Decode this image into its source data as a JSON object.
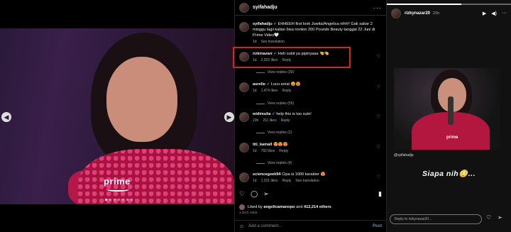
{
  "post": {
    "media_logo": "prime",
    "carousel": {
      "count": 7,
      "active": 0
    },
    "prev_icon": "chevron-left-icon",
    "next_icon": "chevron-right-icon"
  },
  "panel": {
    "username": "syifahadju",
    "more": "···",
    "caption": {
      "username": "syifahadju",
      "text": "EHHEEH first look Juwita/Angelica nihh!! Gak sabar 2 minggu lagii kalian bisa nonton 200 Pounds Beauty tanggal 22 Juni di Prime Video🤍",
      "time": "1d",
      "action": "See translation"
    },
    "comments": [
      {
        "username": "rizkinazarr",
        "text": "Heh cubit ya pipinyaaa 🤏🤏",
        "time": "1d",
        "likes": "2,202 likes",
        "reply": "Reply",
        "replies": "View replies (30)"
      },
      {
        "username": "aurelie",
        "text": "Lucu amat 😆😍",
        "time": "1d",
        "likes": "1,474 likes",
        "reply": "Reply",
        "replies": "View replies (55)"
      },
      {
        "username": "widimulia",
        "text": "help this is too cute!",
        "time": "23h",
        "likes": "211 likes",
        "reply": "Reply",
        "replies": "View replies (2)"
      },
      {
        "username": "titi_kamall",
        "text": "😍😍😍",
        "time": "1d",
        "likes": "782 likes",
        "reply": "Reply",
        "replies": "View replies (4)"
      },
      {
        "username": "sciencegeek94",
        "text": "Cipa si 1000 karakter 😍",
        "time": "1d",
        "likes": "1,231 likes",
        "reply": "Reply",
        "action": "See translation"
      }
    ],
    "liked_by": {
      "prefix": "Liked by",
      "user": "angelicamanopo",
      "joiner": "and",
      "count": "412,214 others"
    },
    "date": "1 DAY AGO",
    "add_comment": {
      "placeholder": "Add a comment...",
      "post": "Post"
    }
  },
  "story": {
    "username": "rizkynazar20",
    "time": "21h",
    "tag": "@syifahadju",
    "caption": "Siapa nih😳...",
    "reply_placeholder": "Reply to rizkynazar20...",
    "frame_logo": "prime"
  },
  "colors": {
    "highlight": "#e0201e",
    "background": "#000000",
    "link": "#6b8fb5"
  }
}
